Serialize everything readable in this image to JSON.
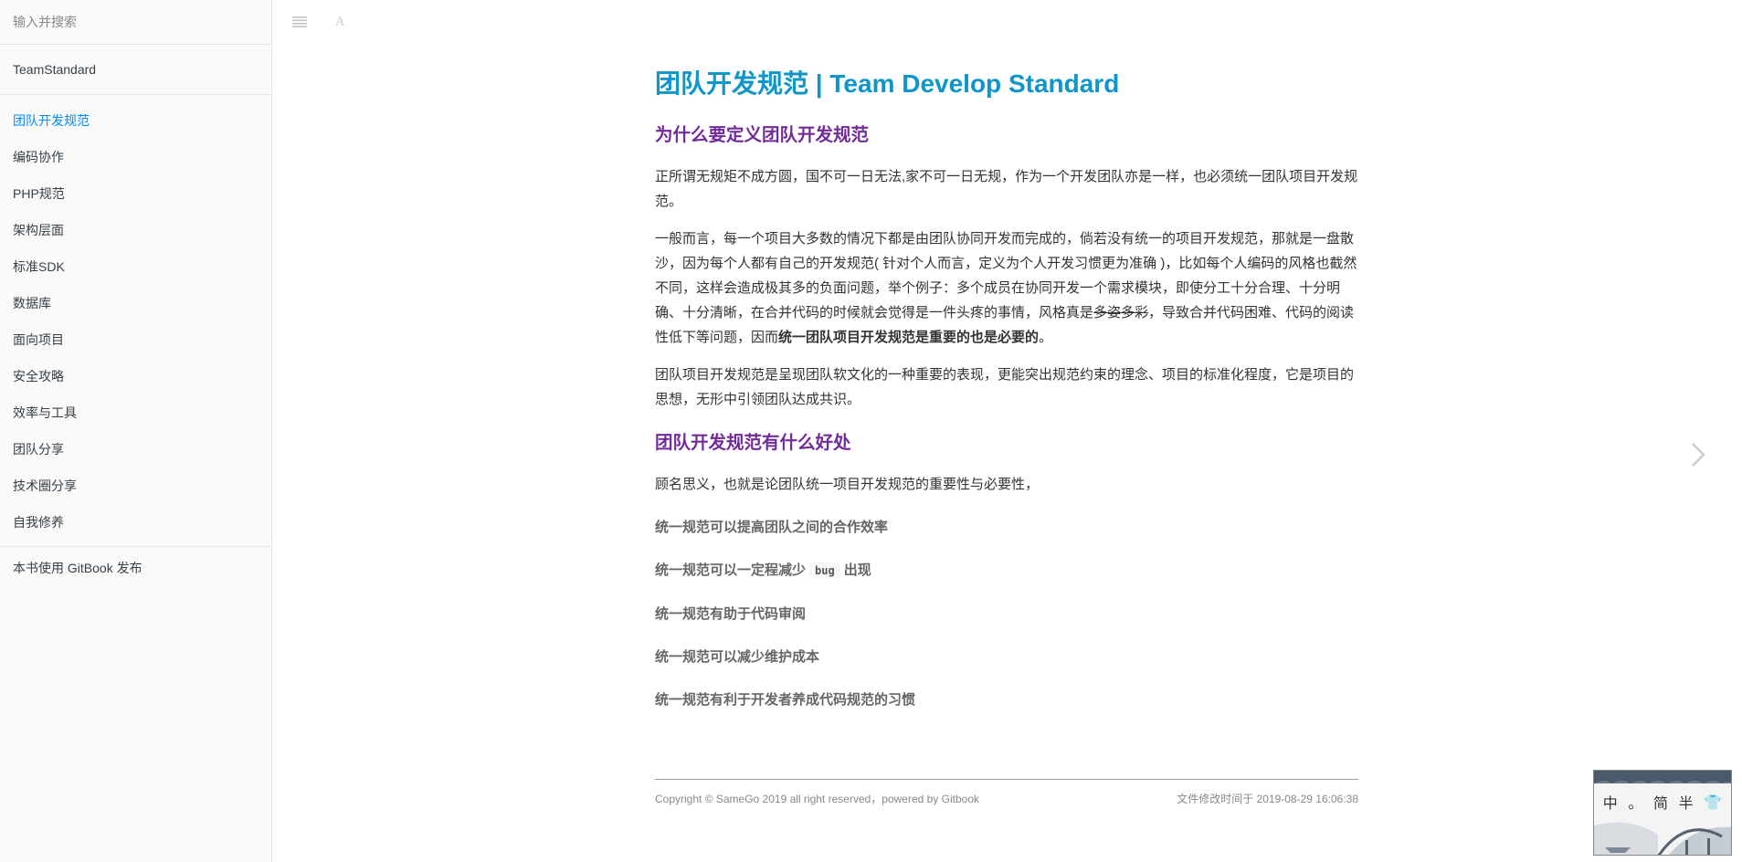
{
  "sidebar": {
    "search_placeholder": "输入并搜索",
    "book_title": "TeamStandard",
    "items": [
      {
        "label": "团队开发规范",
        "active": true
      },
      {
        "label": "编码协作"
      },
      {
        "label": "PHP规范"
      },
      {
        "label": "架构层面"
      },
      {
        "label": "标准SDK"
      },
      {
        "label": "数据库"
      },
      {
        "label": "面向项目"
      },
      {
        "label": "安全攻略"
      },
      {
        "label": "效率与工具"
      },
      {
        "label": "团队分享"
      },
      {
        "label": "技术圈分享"
      },
      {
        "label": "自我修养"
      }
    ],
    "published": "本书使用 GitBook 发布"
  },
  "toolbar": {
    "menu_icon": "menu-icon",
    "font_icon": "font-settings-icon",
    "font_glyph": "A"
  },
  "content": {
    "title": "团队开发规范 | Team Develop Standard",
    "section1_heading": "为什么要定义团队开发规范",
    "p1": "正所谓无规矩不成方圆，国不可一日无法,家不可一日无规，作为一个开发团队亦是一样，也必须统一团队项目开发规范。",
    "p2_a": "一般而言，每一个项目大多数的情况下都是由团队协同开发而完成的，倘若没有统一的项目开发规范，那就是一盘散沙，因为每个人都有自己的开发规范( 针对个人而言，定义为个人开发习惯更为准确 )，比如每个人编码的风格也截然不同，这样会造成极其多的负面问题，举个例子：多个成员在协同开发一个需求模块，即使分工十分合理、十分明确、十分清晰，在合并代码的时候就会觉得是一件头疼的事情，风格真是",
    "p2_del": "多姿多彩",
    "p2_b": "，导致合并代码困难、代码的阅读性低下等问题，因而",
    "p2_strong": "统一团队项目开发规范是重要的也是必要的",
    "p2_end": "。",
    "p3": "团队项目开发规范是呈现团队软文化的一种重要的表现，更能突出规范约束的理念、项目的标准化程度，它是项目的思想，无形中引领团队达成共识。",
    "section2_heading": "团队开发规范有什么好处",
    "p4": "顾名思义，也就是论团队统一项目开发规范的重要性与必要性，",
    "benefit1": "统一规范可以提高团队之间的合作效率",
    "benefit2_a": "统一规范可以一定程减少",
    "benefit2_code": "bug",
    "benefit2_b": "出现",
    "benefit3": "统一规范有助于代码审阅",
    "benefit4": "统一规范可以减少维护成本",
    "benefit5": "统一规范有利于开发者养成代码规范的习惯"
  },
  "footer": {
    "copyright": "Copyright © SameGo 2019 all right reserved，powered by Gitbook",
    "modified": "文件修改时间于 2019-08-29 16:06:38"
  },
  "navigation": {
    "next_icon": "chevron-right-icon"
  },
  "widget": {
    "chars": [
      "中",
      "。",
      "简",
      "半",
      "👕"
    ]
  },
  "colors": {
    "title": "#0e95c9",
    "heading": "#732b9c",
    "active_nav": "#008cff"
  }
}
